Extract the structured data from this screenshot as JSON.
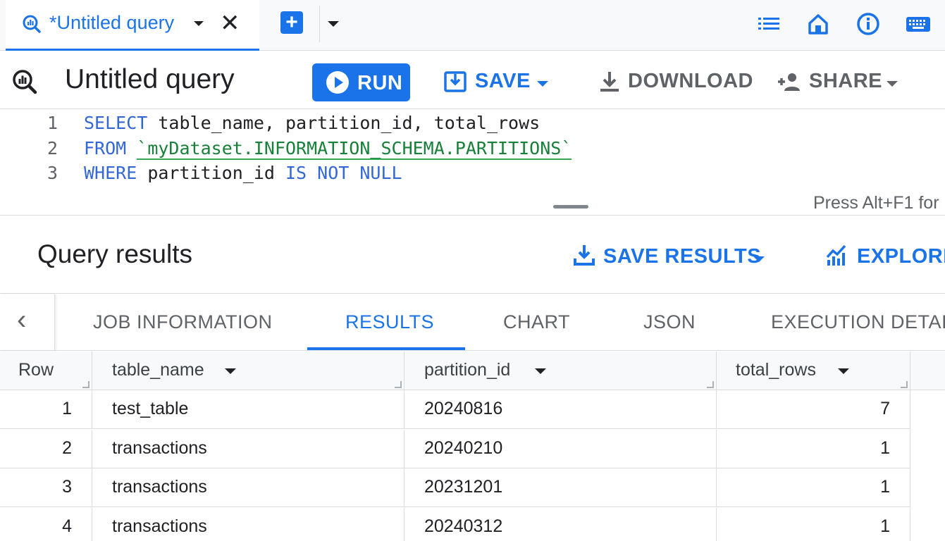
{
  "tabbar": {
    "tab_title": "*Untitled query",
    "close_glyph": "✕",
    "new_tab_glyph": "+",
    "icons": [
      "list-icon",
      "home-icon",
      "info-icon",
      "keyboard-icon"
    ]
  },
  "editor_header": {
    "title": "Untitled query",
    "run_label": "RUN",
    "save_label": "SAVE",
    "download_label": "DOWNLOAD",
    "share_label": "SHARE"
  },
  "editor": {
    "lines": [
      {
        "num": "1",
        "parts": [
          {
            "t": "SELECT",
            "k": "kw"
          },
          {
            "t": " table_name, partition_id, total_rows",
            "k": "plain"
          }
        ]
      },
      {
        "num": "2",
        "parts": [
          {
            "t": "FROM",
            "k": "kw"
          },
          {
            "t": " ",
            "k": "plain"
          },
          {
            "t": "`myDataset.INFORMATION_SCHEMA.PARTITIONS`",
            "k": "str"
          }
        ]
      },
      {
        "num": "3",
        "parts": [
          {
            "t": "WHERE",
            "k": "kw"
          },
          {
            "t": " partition_id ",
            "k": "plain"
          },
          {
            "t": "IS NOT NULL",
            "k": "kw"
          }
        ]
      }
    ],
    "hint": "Press Alt+F1 for"
  },
  "results_header": {
    "title": "Query results",
    "save_results_label": "SAVE RESULTS",
    "explore_label": "EXPLORE"
  },
  "result_tabs": {
    "back_glyph": "‹",
    "tabs": [
      "JOB INFORMATION",
      "RESULTS",
      "CHART",
      "JSON",
      "EXECUTION DETAIL"
    ],
    "active": "RESULTS"
  },
  "table": {
    "columns": [
      "Row",
      "table_name",
      "partition_id",
      "total_rows"
    ],
    "rows": [
      [
        "1",
        "test_table",
        "20240816",
        "7"
      ],
      [
        "2",
        "transactions",
        "20240210",
        "1"
      ],
      [
        "3",
        "transactions",
        "20231201",
        "1"
      ],
      [
        "4",
        "transactions",
        "20240312",
        "1"
      ]
    ]
  },
  "colors": {
    "accent": "#1a73e8",
    "keyword": "#3367d6",
    "string": "#188038",
    "border": "#dadce0"
  }
}
